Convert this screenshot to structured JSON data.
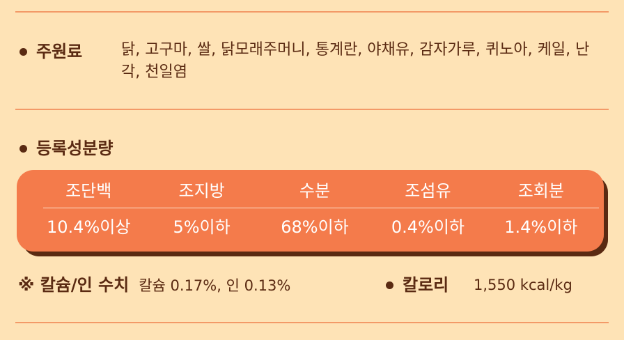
{
  "ingredients": {
    "label": "주원료",
    "value": "닭, 고구마, 쌀, 닭모래주머니, 통계란, 야채유, 감자가루, 퀴노아, 케일, 난각, 천일염"
  },
  "analysis": {
    "title": "등록성분량",
    "headers": [
      "조단백",
      "조지방",
      "수분",
      "조섬유",
      "조회분"
    ],
    "values": [
      "10.4%이상",
      "5%이하",
      "68%이하",
      "0.4%이하",
      "1.4%이하"
    ]
  },
  "mineral": {
    "label": "※ 칼슘/인 수치",
    "value": "칼슘 0.17%, 인 0.13%"
  },
  "calorie": {
    "label": "칼로리",
    "value": "1,550 kcal/kg"
  },
  "colors": {
    "background": "#fee3b6",
    "accent": "#f47b4b",
    "text": "#5a2a12",
    "rule": "#f39a68"
  }
}
